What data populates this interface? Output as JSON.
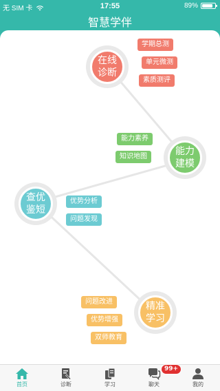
{
  "status_bar": {
    "carrier": "无 SIM 卡",
    "time": "17:55",
    "battery": "89%",
    "battery_level": 0.89
  },
  "nav": {
    "title": "智慧学伴"
  },
  "nodes": {
    "online_diagnosis": {
      "line1": "在线",
      "line2": "诊断",
      "color": "#f17b6c",
      "tags": [
        "学期总测",
        "单元微测",
        "素质测评"
      ]
    },
    "ability_modeling": {
      "line1": "能力",
      "line2": "建模",
      "color": "#7dcb6e",
      "tags": [
        "能力素养",
        "知识地图"
      ]
    },
    "check_identify": {
      "line1": "查优",
      "line2": "鉴短",
      "color": "#6ccbd2",
      "tags": [
        "优势分析",
        "问题发现"
      ]
    },
    "precise_learning": {
      "line1": "精准",
      "line2": "学习",
      "color": "#f8c065",
      "tags": [
        "问题改进",
        "优势增强",
        "双师教育"
      ]
    }
  },
  "tabs": [
    {
      "label": "首页",
      "icon": "home-icon",
      "active": true
    },
    {
      "label": "诊断",
      "icon": "diagnosis-icon"
    },
    {
      "label": "学习",
      "icon": "study-icon"
    },
    {
      "label": "聊天",
      "icon": "chat-icon",
      "badge": "99+"
    },
    {
      "label": "我的",
      "icon": "profile-icon"
    }
  ],
  "colors": {
    "brand": "#35b8aa",
    "badge": "#e03131"
  }
}
